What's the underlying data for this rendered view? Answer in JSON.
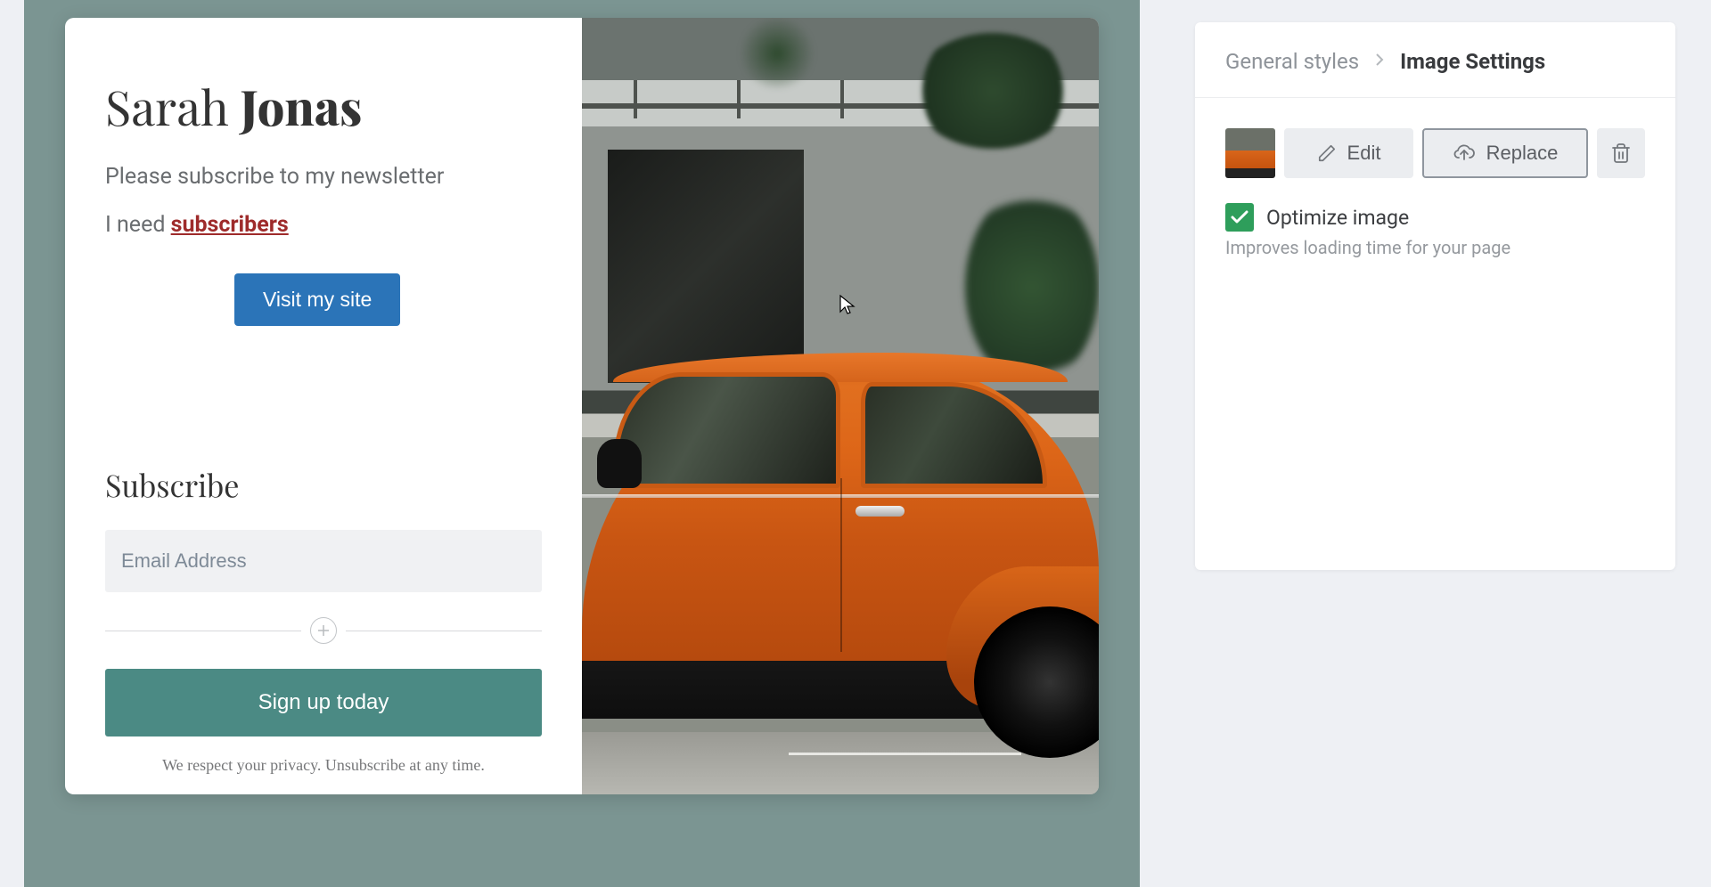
{
  "preview": {
    "heading_first": "Sarah",
    "heading_last": "Jonas",
    "subtitle": "Please subscribe to my newsletter",
    "need_prefix": "I need ",
    "need_link": "subscribers",
    "visit_button": "Visit my site",
    "subscribe_heading": "Subscribe",
    "email_placeholder": "Email Address",
    "signup_button": "Sign up today",
    "privacy": "We respect your privacy. Unsubscribe at any time."
  },
  "panel": {
    "breadcrumb_parent": "General styles",
    "breadcrumb_current": "Image Settings",
    "edit_label": "Edit",
    "replace_label": "Replace",
    "optimize_label": "Optimize image",
    "optimize_desc": "Improves loading time for your page"
  },
  "colors": {
    "primary_button": "#2b74b8",
    "signup_button": "#4b8a84",
    "link": "#9e2b2b",
    "checkbox": "#2e9e5b"
  }
}
